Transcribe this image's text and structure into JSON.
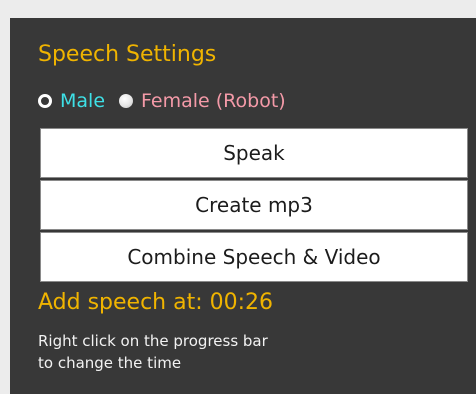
{
  "panel": {
    "title": "Speech Settings",
    "voice": {
      "options": [
        {
          "label": "Male",
          "selected": true,
          "color": "#3ee0e6"
        },
        {
          "label": "Female (Robot)",
          "selected": false,
          "color": "#f49aa8"
        }
      ]
    },
    "buttons": {
      "speak": "Speak",
      "create_mp3": "Create mp3",
      "combine": "Combine Speech & Video"
    },
    "add_speech_label": "Add speech at: 00:26",
    "hint_line1": "Right click on the progress bar",
    "hint_line2": "to change the time"
  },
  "colors": {
    "accent": "#f0b400",
    "panel_bg": "#383838",
    "page_bg": "#ececec"
  }
}
